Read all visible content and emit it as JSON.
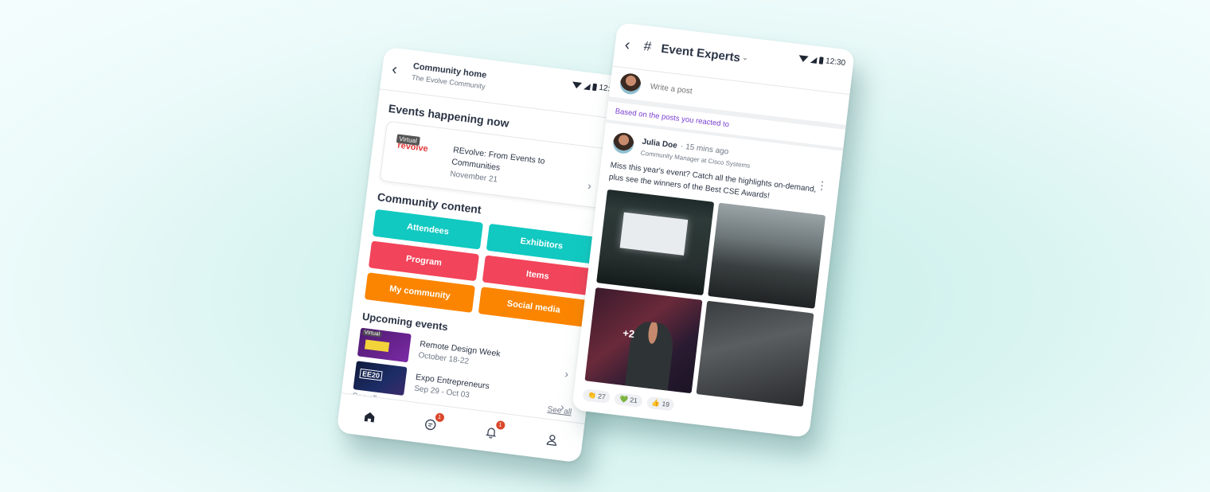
{
  "status_bar": {
    "time": "12:30"
  },
  "community_home": {
    "header": {
      "title": "Community home",
      "subtitle": "The Evolve Community"
    },
    "events_now": {
      "heading": "Events happening now",
      "card": {
        "tag": "Virtual",
        "logo_text": "revolve",
        "title": "REvolve: From Events to Communities",
        "date": "November 21"
      }
    },
    "community_content": {
      "heading": "Community content",
      "tiles": [
        {
          "label": "Attendees",
          "color": "#11c9c1"
        },
        {
          "label": "Exhibitors",
          "color": "#11c9c1"
        },
        {
          "label": "Program",
          "color": "#f2445a"
        },
        {
          "label": "Items",
          "color": "#f2445a"
        },
        {
          "label": "My community",
          "color": "#fb8500"
        },
        {
          "label": "Social media",
          "color": "#fb8500"
        }
      ]
    },
    "upcoming": {
      "heading": "Upcoming events",
      "items": [
        {
          "tag": "Virtual",
          "title": "Remote Design Week",
          "date": "October 18-22"
        },
        {
          "thumb_text": "EE20",
          "title": "Expo Entrepreneurs",
          "date": "Sep 29 - Oct 03"
        }
      ],
      "see_all": "See all"
    },
    "suggested": {
      "heading": "Suggested events",
      "see_all": "See all"
    },
    "bottom_nav": {
      "items": [
        {
          "name": "home",
          "badge": null
        },
        {
          "name": "messages",
          "badge": "1"
        },
        {
          "name": "notifications",
          "badge": "1"
        },
        {
          "name": "profile",
          "badge": null
        }
      ]
    }
  },
  "channel": {
    "header": {
      "title": "Event Experts"
    },
    "compose": {
      "placeholder": "Write a post"
    },
    "based_on": "Based on the posts you reacted to",
    "post": {
      "author": "Julia Doe",
      "time": "· 15 mins ago",
      "role": "Community Manager at Cisco Systems",
      "text": "Miss this year's event? Catch all the highlights on-demand, plus see the winners of the Best CSE Awards!",
      "more_photos": "+2",
      "reactions": [
        {
          "emoji": "👏",
          "count": "27"
        },
        {
          "emoji": "💚",
          "count": "21"
        },
        {
          "emoji": "👍",
          "count": "19"
        }
      ]
    }
  }
}
